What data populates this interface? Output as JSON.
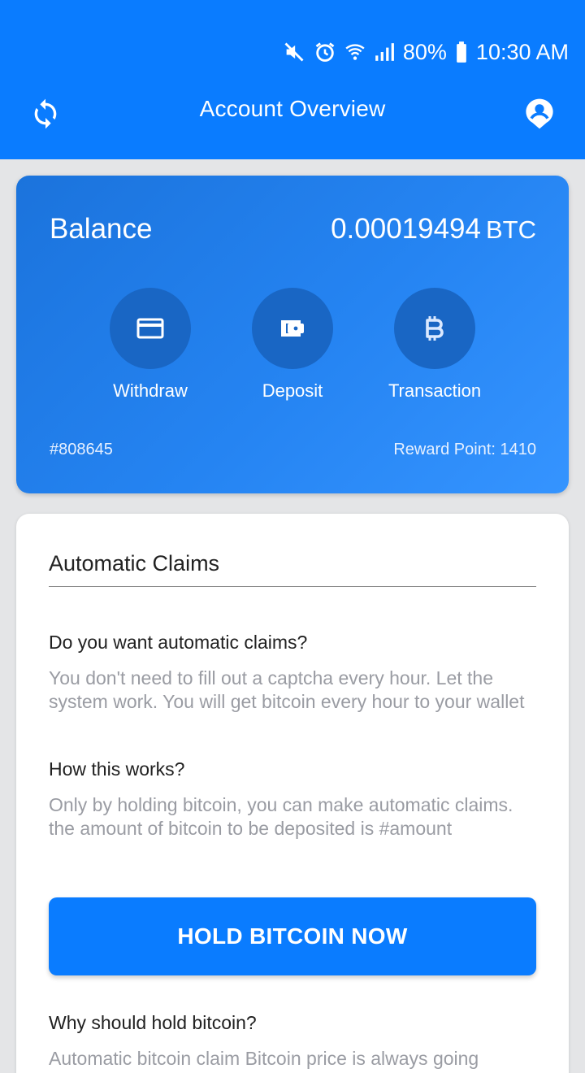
{
  "status_bar": {
    "battery": "80%",
    "time": "10:30 AM",
    "icons": [
      "mute-icon",
      "alarm-icon",
      "wifi-icon",
      "signal-icon",
      "battery-icon"
    ]
  },
  "toolbar": {
    "title": "Account Overview",
    "left_icon": "refresh-icon",
    "right_icon": "account-icon"
  },
  "balance": {
    "label": "Balance",
    "amount": "0.00019494",
    "unit": "BTC",
    "actions": [
      {
        "label": "Withdraw",
        "icon": "card-icon"
      },
      {
        "label": "Deposit",
        "icon": "wallet-icon"
      },
      {
        "label": "Transaction",
        "icon": "bitcoin-icon"
      }
    ],
    "account_id": "#808645",
    "reward_points": "Reward Point: 1410"
  },
  "claims": {
    "title": "Automatic Claims",
    "q1": "Do you want automatic claims?",
    "a1": "You don't need to fill out a captcha every hour. Let the system work. You will get bitcoin every hour to your wallet",
    "q2": "How this works?",
    "a2": "Only by holding bitcoin, you can make automatic claims. the amount of bitcoin to be deposited is #amount",
    "button": "HOLD BITCOIN NOW",
    "q3": "Why should hold bitcoin?",
    "a3": "Automatic bitcoin claim Bitcoin price is always going"
  },
  "colors": {
    "primary": "#0a7cff",
    "card_gradient_start": "#1b73dc",
    "card_gradient_end": "#3594ff",
    "action_circle": "#1966c4",
    "background": "#e4e5e7",
    "muted_text": "#9a9ca3"
  }
}
